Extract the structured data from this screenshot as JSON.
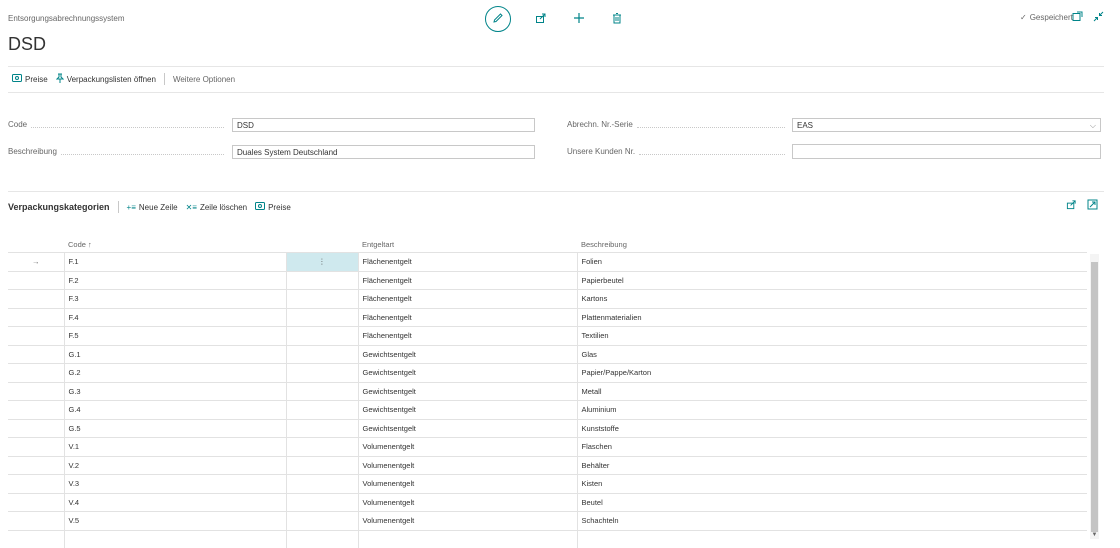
{
  "app": {
    "breadcrumb": "Entsorgungsabrechnungssystem",
    "title": "DSD",
    "saved_label": "Gespeichert"
  },
  "icons": {
    "edit": "pencil-icon",
    "share": "share-icon",
    "new": "plus-icon",
    "delete": "trash-icon",
    "open_new_window": "open-new-window-icon",
    "collapse": "collapse-icon",
    "accent_color": "#008489"
  },
  "actions": {
    "prices": "Preise",
    "open_packaging_lists": "Verpackungslisten öffnen",
    "more_options": "Weitere Optionen"
  },
  "form": {
    "code_label": "Code",
    "code_value": "DSD",
    "description_label": "Beschreibung",
    "description_value": "Duales System Deutschland",
    "billing_series_label": "Abrechn. Nr.-Serie",
    "billing_series_value": "EAS",
    "customer_no_label": "Unsere Kunden Nr.",
    "customer_no_value": ""
  },
  "lines": {
    "title": "Verpackungskategorien",
    "new_line": "Neue Zeile",
    "delete_line": "Zeile löschen",
    "prices": "Preise",
    "columns": {
      "code": "Code ↑",
      "fee_type": "Entgeltart",
      "description": "Beschreibung"
    },
    "rows": [
      {
        "code": "F.1",
        "fee": "Flächenentgelt",
        "desc": "Folien"
      },
      {
        "code": "F.2",
        "fee": "Flächenentgelt",
        "desc": "Papierbeutel"
      },
      {
        "code": "F.3",
        "fee": "Flächenentgelt",
        "desc": "Kartons"
      },
      {
        "code": "F.4",
        "fee": "Flächenentgelt",
        "desc": "Plattenmaterialien"
      },
      {
        "code": "F.5",
        "fee": "Flächenentgelt",
        "desc": "Textilien"
      },
      {
        "code": "G.1",
        "fee": "Gewichtsentgelt",
        "desc": "Glas"
      },
      {
        "code": "G.2",
        "fee": "Gewichtsentgelt",
        "desc": "Papier/Pappe/Karton"
      },
      {
        "code": "G.3",
        "fee": "Gewichtsentgelt",
        "desc": "Metall"
      },
      {
        "code": "G.4",
        "fee": "Gewichtsentgelt",
        "desc": "Aluminium"
      },
      {
        "code": "G.5",
        "fee": "Gewichtsentgelt",
        "desc": "Kunststoffe"
      },
      {
        "code": "V.1",
        "fee": "Volumenentgelt",
        "desc": "Flaschen"
      },
      {
        "code": "V.2",
        "fee": "Volumenentgelt",
        "desc": "Behälter"
      },
      {
        "code": "V.3",
        "fee": "Volumenentgelt",
        "desc": "Kisten"
      },
      {
        "code": "V.4",
        "fee": "Volumenentgelt",
        "desc": "Beutel"
      },
      {
        "code": "V.5",
        "fee": "Volumenentgelt",
        "desc": "Schachteln"
      }
    ]
  }
}
